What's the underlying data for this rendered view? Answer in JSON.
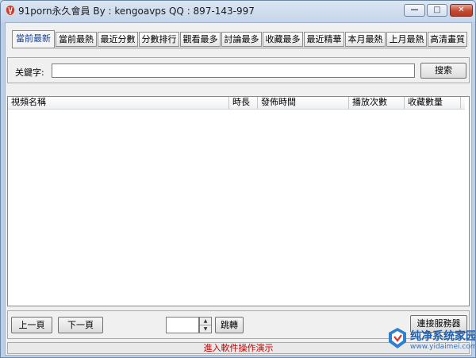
{
  "window": {
    "title": "91porn永久會員 By : kengoavps QQ : 897-143-997",
    "min_glyph": "—",
    "max_glyph": "□",
    "close_glyph": "✕"
  },
  "tabs": [
    {
      "label": "當前最新",
      "active": true
    },
    {
      "label": "當前最熱",
      "active": false
    },
    {
      "label": "最近分數",
      "active": false
    },
    {
      "label": "分數排行",
      "active": false
    },
    {
      "label": "觀看最多",
      "active": false
    },
    {
      "label": "討論最多",
      "active": false
    },
    {
      "label": "收藏最多",
      "active": false
    },
    {
      "label": "最近精華",
      "active": false
    },
    {
      "label": "本月最熱",
      "active": false
    },
    {
      "label": "上月最熱",
      "active": false
    },
    {
      "label": "高清畫質",
      "active": false
    }
  ],
  "search": {
    "label": "关鍵字:",
    "value": "",
    "button": "搜索"
  },
  "grid": {
    "columns": [
      "視頻名稱",
      "時長",
      "發佈時間",
      "播放次數",
      "收藏數量"
    ]
  },
  "pager": {
    "prev": "上一頁",
    "next": "下一頁",
    "page_value": "",
    "jump": "跳轉",
    "connect": "連接服務器"
  },
  "status": {
    "text": "進入軟件操作演示"
  },
  "watermark": {
    "title": "纯净系统家园",
    "url": "www.yidaimei.com"
  }
}
